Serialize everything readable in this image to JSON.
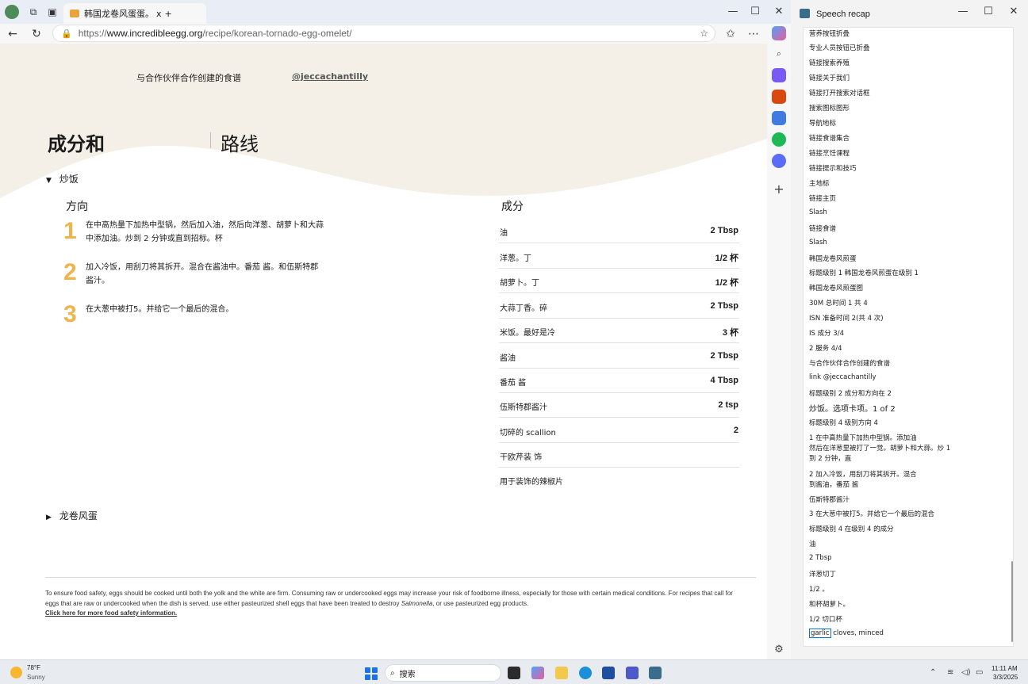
{
  "browser": {
    "tab_title": "韩国龙卷风蛋蛋。",
    "tab_close": "x",
    "new_tab": "+",
    "url_prefix": "https://",
    "url_domain": "www.incredibleegg.org",
    "url_path": "/recipe/korean-tornado-egg-omelet/"
  },
  "page": {
    "partner_text": "与合作伙伴合作创建的食谱",
    "partner_link": "@jeccachantilly",
    "heading_ingredients": "成分和",
    "heading_directions": "路线",
    "toggle_fried_rice": "炒饭",
    "toggle_tornado": "龙卷风蛋",
    "directions_title": "方向",
    "ingredients_title": "成分",
    "steps": [
      {
        "num": "1",
        "text": "在中高热量下加热中型锅，然后加入油，然后向洋葱、胡萝卜和大蒜中添加油。炒到 2 分钟或直到招标。杯"
      },
      {
        "num": "2",
        "text": "加入冷饭，用刮刀将其拆开。混合在酱油中。番茄 酱。和伍斯特郡酱汁。"
      },
      {
        "num": "3",
        "text": "在大葱中被打5。并给它一个最后的混合。"
      }
    ],
    "ingredients": [
      {
        "name": "油",
        "amount": "2 Tbsp"
      },
      {
        "name": "洋葱。丁",
        "amount": "1/2 杯"
      },
      {
        "name": "胡萝卜。丁",
        "amount": "1/2 杯"
      },
      {
        "name": "大蒜丁香。碎",
        "amount": "2 Tbsp"
      },
      {
        "name": "米饭。最好是冷",
        "amount": "3 杯"
      },
      {
        "name": "酱油",
        "amount": "2 Tbsp"
      },
      {
        "name": "番茄 酱",
        "amount": "4 Tbsp"
      },
      {
        "name": "伍斯特郡酱汁",
        "amount": "2 tsp"
      },
      {
        "name": "切碎的 scallion",
        "amount": "2"
      },
      {
        "name": "干欧芹装 饰",
        "amount": ""
      },
      {
        "name": "用于装饰的辣椒片",
        "amount": ""
      }
    ],
    "footer_text_1": "To ensure food safety, eggs should be cooked until both the yolk and the white are firm. Consuming raw or undercooked eggs may increase your risk of foodborne illness, especially for those with certain medical conditions. For recipes that call for eggs that are raw or undercooked when the dish is served, use either pasteurized shell eggs that have been treated to destroy ",
    "footer_salmonella": "Salmonella",
    "footer_text_2": ", or use pasteurized egg products.",
    "footer_link": "Click here for more food safety information."
  },
  "recap": {
    "title": "Speech recap",
    "items": [
      "营养按钮折叠",
      "专业人员按钮已折叠",
      "链接搜索养殖",
      "链接关于我们",
      "链接打开搜索对话框",
      "搜索图标图形",
      "导航地标",
      "链接食谱集合",
      "链接烹饪课程",
      "链接提示和技巧",
      "主地标",
      "链接主页",
      "Slash",
      "链接食谱",
      "Slash",
      "韩国龙卷风煎蛋",
      "标题级别 1 韩国龙卷风煎蛋在级别 1",
      "韩国龙卷风煎蛋图",
      "30M 总时间 1 共 4",
      "ISN 准备时间 2(共 4 次)",
      "IS 成分 3/4",
      "2 服务 4/4",
      "与合作伙伴合作创建的食谱",
      "link @jeccachantilly",
      "标题级别 2 成分和方向在 2",
      "炒饭。选项卡项。1 of 2",
      "标题级别 4 级别方向 4",
      "1 在中高热量下加热中型锅。添加油",
      "然后在洋葱里被打了一觉。胡萝卜和大蒜。炒 1",
      "到 2 分钟，直",
      "2 加入冷饭，用刮刀将其拆开。混合",
      "到酱油，番茄 酱",
      "伍斯特郡酱汁",
      "3 在大葱中被打5。并给它一个最后的混合",
      "标题级别 4 在级别 4 的成分",
      "油",
      "2 Tbsp",
      "洋葱切丁",
      "1/2 。",
      "和杯胡萝卜。",
      "1/2 切口杯",
      "garlic",
      "cloves, minced"
    ]
  },
  "taskbar": {
    "temp": "78°F",
    "weather": "Sunny",
    "search": "搜索",
    "time": "11:11 AM",
    "date": "3/3/2025"
  },
  "colors": {
    "step_number": "#f0b44c",
    "wave": "#f4efe7",
    "focus_outline": "#0078d4"
  }
}
